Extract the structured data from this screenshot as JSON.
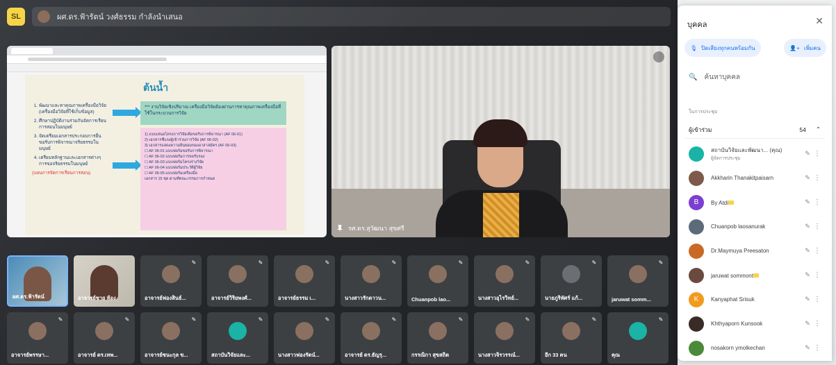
{
  "header": {
    "app_badge": "SL",
    "meeting_title": "ผศ.ดร.ฟ้ารัตน์ วงศ์ธรรม กำลังนำเสนอ"
  },
  "presentation": {
    "slide_title": "ต้นน้ำ",
    "list": [
      "พัฒนาและหาคุณภาพเครื่องมือวิจัย (เครื่องมือวิจัยที่ใช้เก็บข้อมูล)",
      "ศึกษาปฏิบัติงานร่วมกันจัดการเรียนการสอนในมนุษย์",
      "จัดเตรียมเอกสารประกอบการยื่นขอรับการพิจารณาจริยธรรมในมนุษย์",
      "เตรียมหลักฐานและเอกสารต่างๆ การขอจริยธรรมในมนุษย์"
    ],
    "list_note": "(แผนการจัดการเรียนการสอน)",
    "green_box": "*** งานวิจัยเชิงปริมาณ เครื่องมือวิจัยต้องผ่านการหาคุณภาพเครื่องมือที่ใช้ในกระบวนการวิจัย",
    "pink_rows": [
      "1) แบบเสนอโครงการวิจัยเพื่อขอรับการพิจารณา (AF 06-01)",
      "2) เอกสารชี้แจงผู้เข้าร่วมการวิจัย (AF 06-02)",
      "3) เอกสารแสดงความยินยอมของอาสาสมัคร (AF 06-03)",
      "☐ AF 06-01 แบบฟอร์มขอรับการพิจารณา",
      "☐ AF 06-02 แบบฟอร์มการขอรับรอง",
      "☐ AF 06-03 แบบฟอร์มโครงร่างวิจัย",
      "☐ AF 06-04 แบบฟอร์มประวัติผู้วิจัย",
      "☐ AF 06-05 แบบฟอร์มเครื่องมือ",
      "เอกสาร 15 ชุด ตามที่คณะกรรมการกำหนด"
    ]
  },
  "speaker": {
    "name": "รศ.ดร.สุวัฒนา สุขศรี"
  },
  "grid": [
    {
      "name": "ผศ.ดร.ฟ้ารัตน์",
      "type": "video1"
    },
    {
      "name": "อาจารย์ชาย ห้อง",
      "type": "video2"
    },
    {
      "name": "อาจารย์ฟองสินธ์...",
      "type": "avatar"
    },
    {
      "name": "อาจารย์วิริยพงศ์...",
      "type": "avatar"
    },
    {
      "name": "อาจารย์ธรรม เ...",
      "type": "avatar"
    },
    {
      "name": "นางสาวรักดาวน...",
      "type": "avatar"
    },
    {
      "name": "Chuanpob lao...",
      "type": "avatar"
    },
    {
      "name": "นางสาวอุไรวิทย์...",
      "type": "avatar"
    },
    {
      "name": "นายภูริพัศร์ แก้...",
      "type": "grey"
    },
    {
      "name": "jaruwat somm...",
      "type": "avatar"
    },
    {
      "name": "อาจารย์พรรษา...",
      "type": "avatar"
    },
    {
      "name": "อาจารย์ ดร.เทพ...",
      "type": "avatar"
    },
    {
      "name": "อาจารย์ชนะกุล ข...",
      "type": "avatar"
    },
    {
      "name": "สถาบันวิจัยและ...",
      "type": "teal"
    },
    {
      "name": "นางสาวฟองรัตน์...",
      "type": "avatar"
    },
    {
      "name": "อาจารย์ ดร.ธัญรุ...",
      "type": "avatar"
    },
    {
      "name": "กรรณิกา สุขสถิต",
      "type": "avatar"
    },
    {
      "name": "นางสาวจิรวรรณ์...",
      "type": "avatar"
    },
    {
      "name": "อีก 33 คน",
      "type": "avatar"
    },
    {
      "name": "คุณ",
      "type": "teal"
    }
  ],
  "panel": {
    "title": "บุคคล",
    "close": "✕",
    "btn_mute_all": "ปิดเสียงทุกคนพร้อมกัน",
    "btn_add": "เพิ่มคน",
    "search_placeholder": "ค้นหาบุคคล",
    "section_caption": "ในการประชุม",
    "group_label": "ผู้เข้าร่วม",
    "group_count": "54",
    "participants": [
      {
        "name": "สถาบันวิจัยและพัฒนา... (คุณ)",
        "sub": "ผู้จัดการประชุม",
        "color": "#1ab3a6",
        "initial": ""
      },
      {
        "name": "Akkharin Thanakitpaisarn",
        "sub": "",
        "color": "#7d5a4a",
        "initial": ""
      },
      {
        "name": "By Atdi",
        "sub": "",
        "color": "#7b3fd1",
        "initial": "B",
        "host": true
      },
      {
        "name": "Chuanpob laosanurak",
        "sub": "",
        "color": "#5b6b7a",
        "initial": ""
      },
      {
        "name": "Dr.Maymuya Preesaton",
        "sub": "",
        "color": "#c96a24",
        "initial": ""
      },
      {
        "name": "jaruwat sommont",
        "sub": "",
        "color": "#6a4a3e",
        "initial": "",
        "host": true
      },
      {
        "name": "Kanyaphat Srisuk",
        "sub": "",
        "color": "#f29a1e",
        "initial": "K"
      },
      {
        "name": "Khthyaporn Kunsook",
        "sub": "",
        "color": "#3a2b26",
        "initial": ""
      },
      {
        "name": "nosakorn ymolkechan",
        "sub": "",
        "color": "#4a8a3a",
        "initial": ""
      }
    ]
  },
  "colors": {
    "accent": "#1a73e8",
    "stage_bg": "#25272b",
    "tile_bg": "#3c4043",
    "host_tag": "#f6d44a"
  }
}
